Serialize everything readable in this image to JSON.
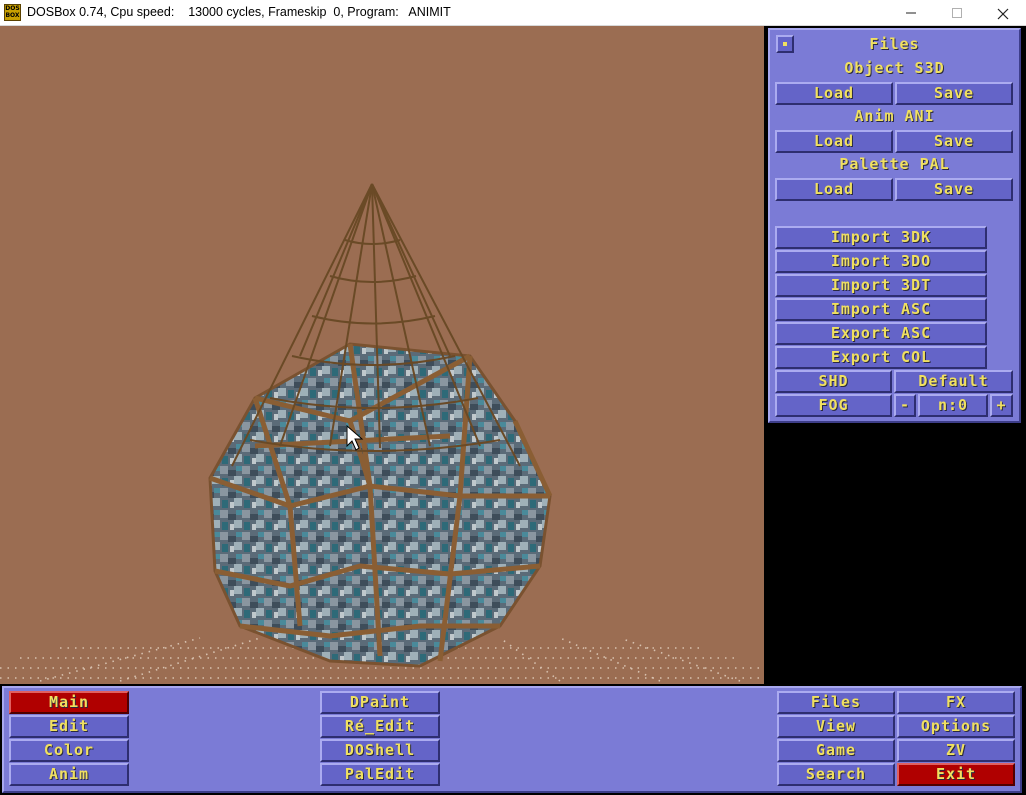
{
  "window": {
    "title": "DOSBox 0.74, Cpu speed:    13000 cycles, Frameskip  0, Program:   ANIMIT",
    "icon_text": "DOS BOX",
    "minimize_icon": "minimize-icon",
    "maximize_icon": "maximize-icon",
    "close_icon": "close-icon"
  },
  "files_panel": {
    "title": "Files",
    "object_label": "Object S3D",
    "anim_label": "Anim ANI",
    "palette_label": "Palette PAL",
    "load": "Load",
    "save": "Save",
    "import_3dk": "Import 3DK",
    "import_3do": "Import 3DO",
    "import_3dt": "Import 3DT",
    "import_asc": "Import ASC",
    "export_asc": "Export ASC",
    "export_col": "Export COL",
    "shd": "SHD",
    "default": "Default",
    "fog": "FOG",
    "minus": "-",
    "n_value": "n:0",
    "plus": "+"
  },
  "bottom_menu": {
    "left": [
      "Main",
      "Edit",
      "Color",
      "Anim"
    ],
    "middle": [
      "DPaint",
      "Ré_Edit",
      "DOShell",
      "PalEdit"
    ],
    "right_col1": [
      "Files",
      "View",
      "Game",
      "Search"
    ],
    "right_col2": [
      "FX",
      "Options",
      "ZV",
      "Exit"
    ]
  },
  "colors": {
    "background": "#9b6d52",
    "panel": "#7b7bd6",
    "button": "#6464c8",
    "text": "#f0e060",
    "active_red": "#b00000"
  }
}
